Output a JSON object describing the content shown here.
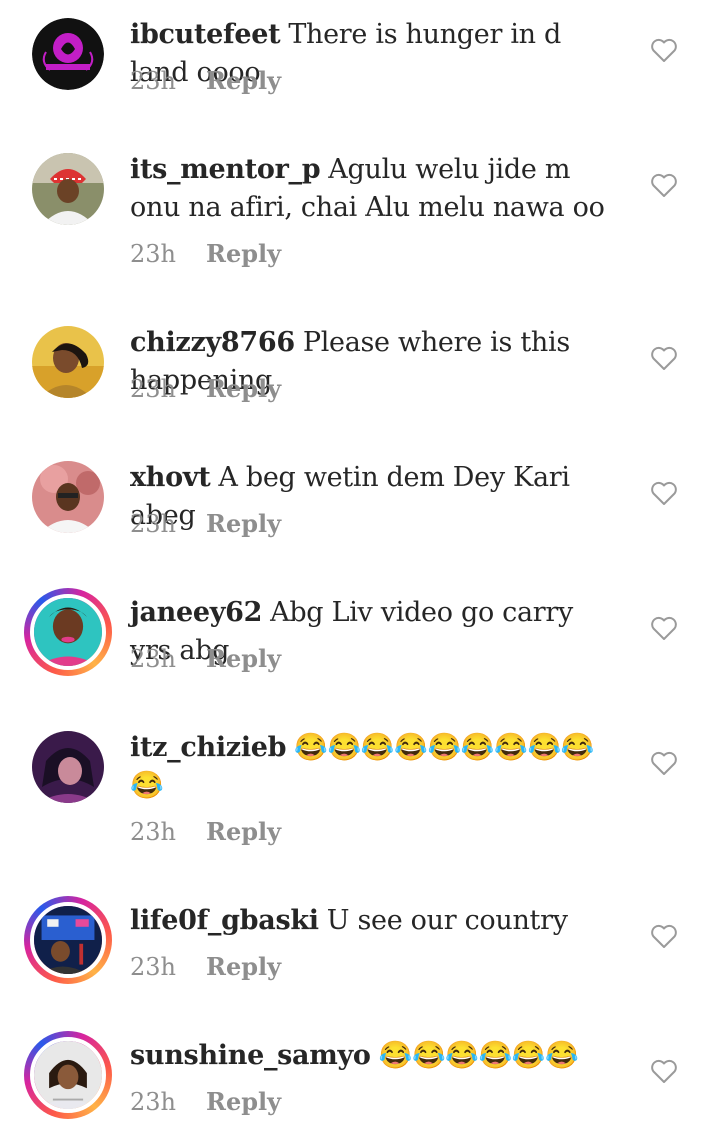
{
  "comments": [
    {
      "username": "ibcutefeet",
      "text": "There is hunger in d land oooo",
      "time": "23h",
      "reply": "Reply",
      "avatar_icon": "brand-logo-avatar"
    },
    {
      "username": "its_mentor_p",
      "text": "Agulu welu jide m onu na afiri, chai Alu melu nawa oo",
      "time": "23h",
      "reply": "Reply",
      "avatar_icon": "user-photo-avatar"
    },
    {
      "username": "chizzy8766",
      "text": "Please where is this happening",
      "time": "23h",
      "reply": "Reply",
      "avatar_icon": "user-photo-avatar"
    },
    {
      "username": "xhovt",
      "text": "A beg wetin dem Dey Kari abeg",
      "time": "23h",
      "reply": "Reply",
      "avatar_icon": "user-photo-avatar"
    },
    {
      "username": "janeey62",
      "text": "Abg Liv video go carry yrs abg",
      "time": "23h",
      "reply": "Reply",
      "avatar_icon": "user-photo-avatar"
    },
    {
      "username": "itz_chizieb",
      "text": "😂😂😂😂😂😂😂😂😂😂",
      "time": "23h",
      "reply": "Reply",
      "avatar_icon": "user-photo-avatar"
    },
    {
      "username": "life0f_gbaski",
      "text": "U see our country",
      "time": "23h",
      "reply": "Reply",
      "avatar_icon": "user-photo-avatar"
    },
    {
      "username": "sunshine_samyo",
      "text": "😂😂😂😂😂😂",
      "time": "23h",
      "reply": "Reply",
      "avatar_icon": "user-photo-avatar"
    }
  ],
  "icons": {
    "like": "heart-outline-icon"
  },
  "colors": {
    "story_ring_start": "#fd5949",
    "story_ring_mid": "#d6249f",
    "meta_text": "#8e8e8e"
  }
}
